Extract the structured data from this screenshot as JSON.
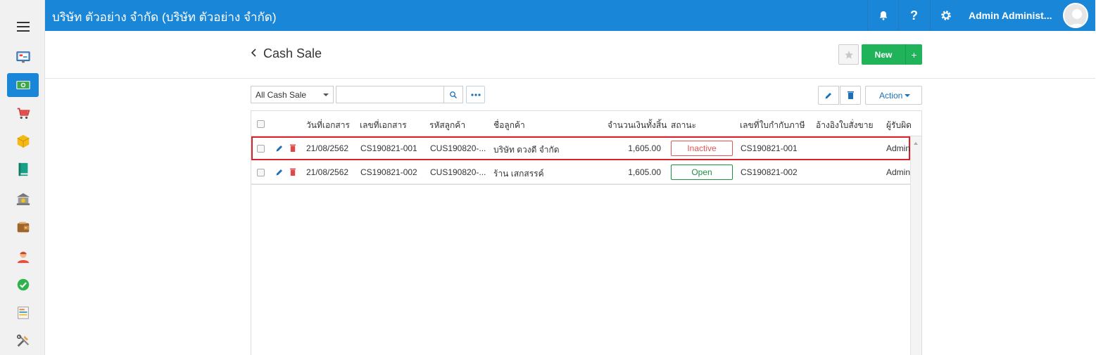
{
  "topbar": {
    "company": "บริษัท ตัวอย่าง จำกัด (บริษัท ตัวอย่าง จำกัด)",
    "user_name": "Admin Administ...",
    "color": "#1a86d8"
  },
  "sidebar": {
    "items": [
      {
        "icon": "dashboard-icon"
      },
      {
        "icon": "money-icon",
        "active": true
      },
      {
        "icon": "cart-icon"
      },
      {
        "icon": "box-icon"
      },
      {
        "icon": "book-icon"
      },
      {
        "icon": "bank-icon"
      },
      {
        "icon": "wallet-icon"
      },
      {
        "icon": "contact-icon"
      },
      {
        "icon": "check-circle-icon"
      },
      {
        "icon": "report-icon"
      },
      {
        "icon": "tools-icon"
      }
    ]
  },
  "header": {
    "title": "Cash Sale",
    "new_label": "New",
    "plus_label": "+"
  },
  "filter": {
    "selected": "All Cash Sale",
    "search_value": "",
    "action_label": "Action"
  },
  "table": {
    "columns": [
      "วันที่เอกสาร",
      "เลขที่เอกสาร",
      "รหัสลูกค้า",
      "ชื่อลูกค้า",
      "จำนวนเงินทั้งสิ้น",
      "สถานะ",
      "เลขที่ใบกำกับภาษี",
      "อ้างอิงใบสั่งขาย",
      "ผู้รับผิด"
    ],
    "rows": [
      {
        "date": "21/08/2562",
        "doc_no": "CS190821-001",
        "customer_code": "CUS190820-...",
        "customer_name": "บริษัท ดวงดี จำกัด",
        "amount": "1,605.00",
        "status": "Inactive",
        "tax_invoice": "CS190821-001",
        "sales_order": "",
        "owner": "Admin"
      },
      {
        "date": "21/08/2562",
        "doc_no": "CS190821-002",
        "customer_code": "CUS190820-...",
        "customer_name": "ร้าน เสกสรรค์",
        "amount": "1,605.00",
        "status": "Open",
        "tax_invoice": "CS190821-002",
        "sales_order": "",
        "owner": "Admin"
      }
    ]
  },
  "colors": {
    "accent": "#1a86d8",
    "new_button": "#21b359",
    "inactive": "#e15555",
    "open": "#1e8f45",
    "highlight": "#d9232e"
  }
}
